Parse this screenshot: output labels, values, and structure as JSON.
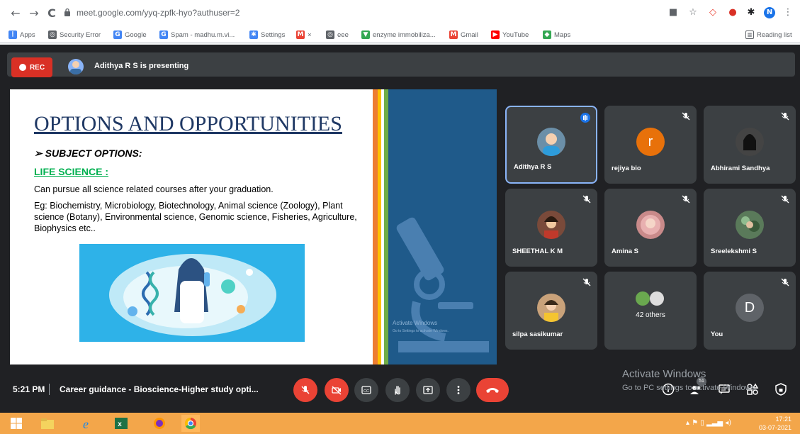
{
  "browser": {
    "nav": {
      "back": "←",
      "forward": "→",
      "reload": "C"
    },
    "url": "meet.google.com/yyq-zpfk-hyo?authuser=2",
    "profile_initial": "N",
    "bookmarks": [
      {
        "label": "Apps",
        "color": "#4285f4",
        "glyph": "⋮"
      },
      {
        "label": "Security Error",
        "color": "#5f6368",
        "glyph": "◎"
      },
      {
        "label": "Google",
        "color": "#4285f4",
        "glyph": "G"
      },
      {
        "label": "Spam - madhu.m.vi...",
        "color": "#4285f4",
        "glyph": "G"
      },
      {
        "label": "Settings",
        "color": "#4285f4",
        "glyph": "✱"
      },
      {
        "label": "×",
        "color": "#ea4335",
        "glyph": "M"
      },
      {
        "label": "eee",
        "color": "#5f6368",
        "glyph": "◎"
      },
      {
        "label": "enzyme immobiliza...",
        "color": "#34a853",
        "glyph": "▼"
      },
      {
        "label": "Gmail",
        "color": "#ea4335",
        "glyph": "M"
      },
      {
        "label": "YouTube",
        "color": "#ff0000",
        "glyph": "▶"
      },
      {
        "label": "Maps",
        "color": "#34a853",
        "glyph": "◆"
      }
    ],
    "reading_list": "Reading list"
  },
  "meet": {
    "rec_label": "REC",
    "presenting_text": "Adithya R S is presenting",
    "slide": {
      "title": "OPTIONS AND OPPORTUNITIES",
      "subject_options": "➢ SUBJECT OPTIONS:",
      "life_science": "LIFE SCIENCE :",
      "description": "Can pursue all science related courses after your graduation.",
      "example": "Eg: Biochemistry, Microbiology, Biotechnology, Animal science (Zoology), Plant science (Botany), Environmental science, Genomic science, Fisheries, Agriculture, Biophysics etc..",
      "activate_windows": "Activate Windows",
      "activate_windows_sub": "Go to Settings to activate Windows."
    },
    "participants": [
      {
        "name": "Adithya R S",
        "avatar": "photo",
        "avatar_color": "#6b8fa8",
        "speaking": true
      },
      {
        "name": "rejiya bio",
        "avatar": "letter",
        "letter": "r",
        "avatar_color": "#e8710a",
        "muted": true
      },
      {
        "name": "Abhirami Sandhya",
        "avatar": "photo",
        "avatar_color": "#444444",
        "muted": true
      },
      {
        "name": "SHEETHAL K M",
        "avatar": "photo",
        "avatar_color": "#7a4a3a",
        "muted": true
      },
      {
        "name": "Amina S",
        "avatar": "photo",
        "avatar_color": "#c98a8a",
        "muted": true
      },
      {
        "name": "Sreelekshmi S",
        "avatar": "photo",
        "avatar_color": "#5a7a5a",
        "muted": true
      },
      {
        "name": "silpa sasikumar",
        "avatar": "photo",
        "avatar_color": "#c9a27a",
        "muted": true
      },
      {
        "name": "42 others",
        "avatar": "group"
      },
      {
        "name": "You",
        "avatar": "letter",
        "letter": "D",
        "avatar_color": "#5f6368",
        "muted": true
      }
    ],
    "bottom": {
      "time": "5:21 PM",
      "meeting_title": "Career guidance - Bioscience-Higher study opti...",
      "participant_count": "51",
      "watermark_title": "Activate Windows",
      "watermark_sub": "Go to PC settings to activate Windows."
    }
  },
  "taskbar": {
    "clock_time": "17:21",
    "clock_date": "03-07-2021"
  }
}
